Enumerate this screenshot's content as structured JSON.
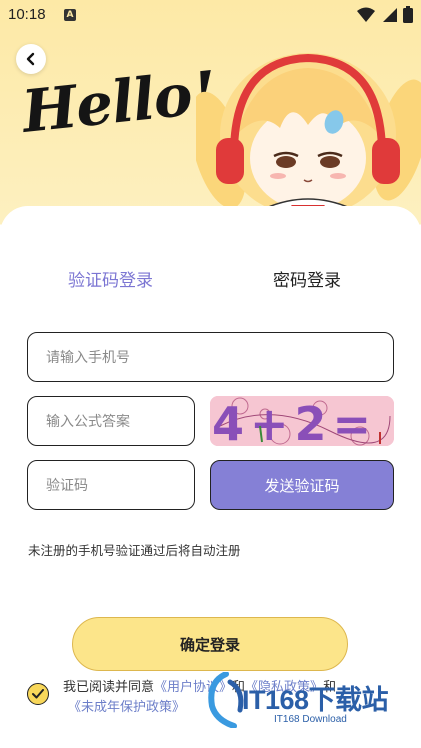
{
  "status_bar": {
    "time": "10:18",
    "indicator": "A",
    "icons": [
      "wifi-icon",
      "signal-icon",
      "battery-icon"
    ]
  },
  "header": {
    "back_icon": "back-chevron-icon",
    "greeting": "Hello!"
  },
  "tabs": [
    {
      "label": "验证码登录",
      "active": true
    },
    {
      "label": "密码登录",
      "active": false
    }
  ],
  "form": {
    "phone_placeholder": "请输入手机号",
    "formula_placeholder": "输入公式答案",
    "captcha_text": "4+2=",
    "code_placeholder": "验证码",
    "send_code_label": "发送验证码"
  },
  "hint": "未注册的手机号验证通过后将自动注册",
  "confirm_label": "确定登录",
  "agreement": {
    "prefix": "我已阅读并同意",
    "user_agreement": "《用户协议》",
    "and1": "和",
    "privacy_policy": "《隐私政策》",
    "and2": "和",
    "minor_policy": "《未成年保护政策》"
  },
  "watermark": {
    "main": "IT168下载站",
    "sub": "IT168 Download"
  },
  "colors": {
    "accent_purple": "#8580d6",
    "accent_yellow": "#fce58a",
    "header_bg": "#fde9a6"
  }
}
